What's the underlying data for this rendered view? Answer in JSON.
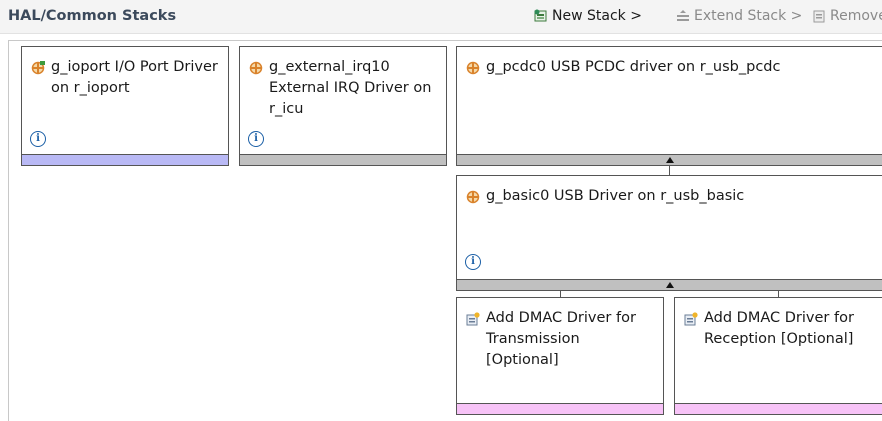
{
  "header": {
    "title": "HAL/Common Stacks",
    "new_stack": "New Stack >",
    "extend_stack": "Extend Stack >",
    "remove": "Remove"
  },
  "nodes": {
    "ioport": {
      "label": "g_ioport I/O Port Driver on r_ioport",
      "icon": "driver-module-icon"
    },
    "irq": {
      "label": "g_external_irq10 External IRQ Driver on r_icu",
      "icon": "driver-module-icon"
    },
    "pcdc": {
      "label": "g_pcdc0 USB PCDC driver on r_usb_pcdc",
      "icon": "driver-module-icon"
    },
    "basic": {
      "label": "g_basic0 USB Driver on r_usb_basic",
      "icon": "driver-module-icon"
    },
    "dmac_tx": {
      "label": "Add DMAC Driver for Transmission [Optional]",
      "icon": "add-driver-icon"
    },
    "dmac_rx": {
      "label": "Add DMAC Driver for Reception [Optional]",
      "icon": "add-driver-icon"
    }
  },
  "colors": {
    "bar_blue": "#b9b9f5",
    "bar_gray": "#c0c0c0",
    "bar_pink": "#f7c3f7",
    "info_blue": "#1b5fa6",
    "module_orange": "#d9822b"
  }
}
